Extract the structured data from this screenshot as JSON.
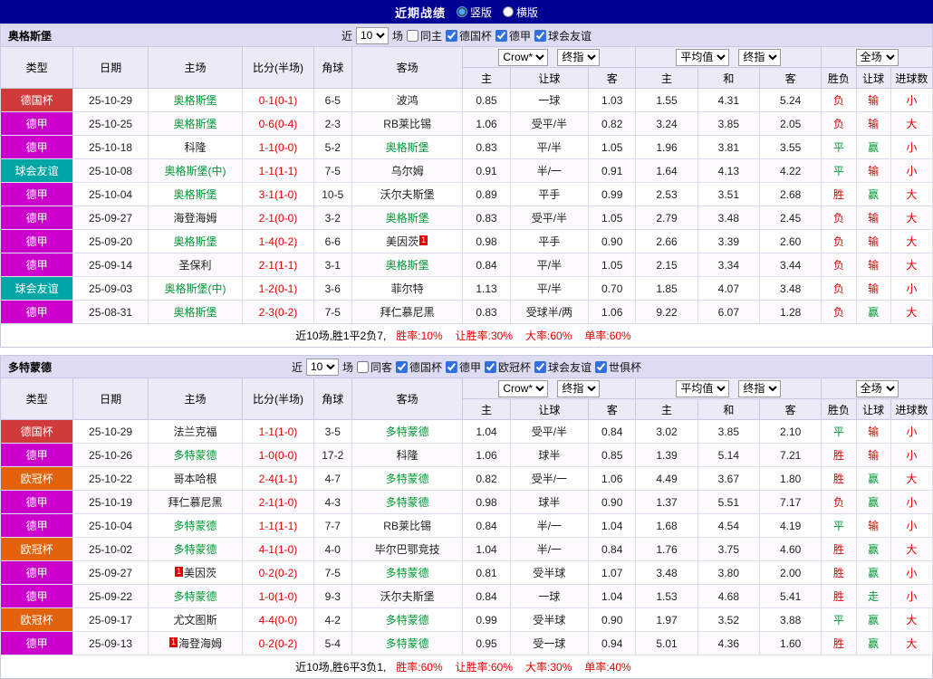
{
  "page": {
    "title": "近期战绩",
    "layout_options": [
      {
        "label": "竖版",
        "selected": true
      },
      {
        "label": "横版",
        "selected": false
      }
    ]
  },
  "colors": {
    "red": "#e60000",
    "green": "#009933",
    "focal_team": "#009933",
    "topbar_bg": "#000093",
    "result_colors": {
      "胜": "#e60000",
      "负": "#e60000",
      "平": "#009933",
      "赢": "#009933",
      "输": "#e60000",
      "走": "#009933",
      "大": "#e60000",
      "小": "#e60000"
    },
    "league_colors": {
      "德国杯": "#d03a3a",
      "德甲": "#cc00cc",
      "球会友谊": "#00a6a6",
      "欧冠杯": "#e2620d"
    }
  },
  "filter_labels": {
    "prefix": "近",
    "count": "10",
    "suffix": "场"
  },
  "table_header": {
    "static_cols": [
      "类型",
      "日期",
      "主场",
      "比分(半场)",
      "角球",
      "客场"
    ],
    "groups": [
      {
        "selects": [
          "Crow*",
          "终指"
        ],
        "sub": [
          "主",
          "让球",
          "客"
        ]
      },
      {
        "selects": [
          "平均值",
          "终指"
        ],
        "sub": [
          "主",
          "和",
          "客"
        ]
      },
      {
        "selects": [
          "全场"
        ],
        "sub": [
          "胜负",
          "让球",
          "进球数"
        ]
      }
    ]
  },
  "sections": [
    {
      "team": "奥格斯堡",
      "venue_filter": {
        "label": "同主",
        "checked": false
      },
      "league_filters": [
        {
          "label": "德国杯",
          "checked": true
        },
        {
          "label": "德甲",
          "checked": true
        },
        {
          "label": "球会友谊",
          "checked": true
        }
      ],
      "rows": [
        {
          "league": "德国杯",
          "date": "25-10-29",
          "home": {
            "name": "奥格斯堡",
            "focal": true
          },
          "score": "0-1(0-1)",
          "corners": "6-5",
          "away": {
            "name": "波鸿"
          },
          "asian": [
            "0.85",
            "一球",
            "1.03"
          ],
          "euro": [
            "1.55",
            "4.31",
            "5.24"
          ],
          "results": [
            "负",
            "输",
            "小"
          ]
        },
        {
          "league": "德甲",
          "date": "25-10-25",
          "home": {
            "name": "奥格斯堡",
            "focal": true
          },
          "score": "0-6(0-4)",
          "corners": "2-3",
          "away": {
            "name": "RB莱比锡"
          },
          "asian": [
            "1.06",
            "受平/半",
            "0.82"
          ],
          "euro": [
            "3.24",
            "3.85",
            "2.05"
          ],
          "results": [
            "负",
            "输",
            "大"
          ]
        },
        {
          "league": "德甲",
          "date": "25-10-18",
          "home": {
            "name": "科隆"
          },
          "score": "1-1(0-0)",
          "corners": "5-2",
          "away": {
            "name": "奥格斯堡",
            "focal": true
          },
          "asian": [
            "0.83",
            "平/半",
            "1.05"
          ],
          "euro": [
            "1.96",
            "3.81",
            "3.55"
          ],
          "results": [
            "平",
            "赢",
            "小"
          ]
        },
        {
          "league": "球会友谊",
          "date": "25-10-08",
          "home": {
            "name": "奥格斯堡(中)",
            "focal": true
          },
          "score": "1-1(1-1)",
          "corners": "7-5",
          "away": {
            "name": "乌尔姆"
          },
          "asian": [
            "0.91",
            "半/一",
            "0.91"
          ],
          "euro": [
            "1.64",
            "4.13",
            "4.22"
          ],
          "results": [
            "平",
            "输",
            "小"
          ]
        },
        {
          "league": "德甲",
          "date": "25-10-04",
          "home": {
            "name": "奥格斯堡",
            "focal": true
          },
          "score": "3-1(1-0)",
          "corners": "10-5",
          "away": {
            "name": "沃尔夫斯堡"
          },
          "asian": [
            "0.89",
            "平手",
            "0.99"
          ],
          "euro": [
            "2.53",
            "3.51",
            "2.68"
          ],
          "results": [
            "胜",
            "赢",
            "大"
          ]
        },
        {
          "league": "德甲",
          "date": "25-09-27",
          "home": {
            "name": "海登海姆"
          },
          "score": "2-1(0-0)",
          "corners": "3-2",
          "away": {
            "name": "奥格斯堡",
            "focal": true
          },
          "asian": [
            "0.83",
            "受平/半",
            "1.05"
          ],
          "euro": [
            "2.79",
            "3.48",
            "2.45"
          ],
          "results": [
            "负",
            "输",
            "大"
          ]
        },
        {
          "league": "德甲",
          "date": "25-09-20",
          "home": {
            "name": "奥格斯堡",
            "focal": true
          },
          "score": "1-4(0-2)",
          "corners": "6-6",
          "away": {
            "name": "美因茨",
            "red_card": "1",
            "badge_pos": "after"
          },
          "asian": [
            "0.98",
            "平手",
            "0.90"
          ],
          "euro": [
            "2.66",
            "3.39",
            "2.60"
          ],
          "results": [
            "负",
            "输",
            "大"
          ]
        },
        {
          "league": "德甲",
          "date": "25-09-14",
          "home": {
            "name": "圣保利"
          },
          "score": "2-1(1-1)",
          "corners": "3-1",
          "away": {
            "name": "奥格斯堡",
            "focal": true
          },
          "asian": [
            "0.84",
            "平/半",
            "1.05"
          ],
          "euro": [
            "2.15",
            "3.34",
            "3.44"
          ],
          "results": [
            "负",
            "输",
            "大"
          ]
        },
        {
          "league": "球会友谊",
          "date": "25-09-03",
          "home": {
            "name": "奥格斯堡(中)",
            "focal": true
          },
          "score": "1-2(0-1)",
          "corners": "3-6",
          "away": {
            "name": "菲尔特"
          },
          "asian": [
            "1.13",
            "平/半",
            "0.70"
          ],
          "euro": [
            "1.85",
            "4.07",
            "3.48"
          ],
          "results": [
            "负",
            "输",
            "小"
          ]
        },
        {
          "league": "德甲",
          "date": "25-08-31",
          "home": {
            "name": "奥格斯堡",
            "focal": true
          },
          "score": "2-3(0-2)",
          "corners": "7-5",
          "away": {
            "name": "拜仁慕尼黑"
          },
          "asian": [
            "0.83",
            "受球半/两",
            "1.06"
          ],
          "euro": [
            "9.22",
            "6.07",
            "1.28"
          ],
          "results": [
            "负",
            "赢",
            "大"
          ]
        }
      ],
      "summary": {
        "prefix": "近10场,胜1平2负7,",
        "stats": [
          "胜率:10%",
          "让胜率:30%",
          "大率:60%",
          "单率:60%"
        ]
      }
    },
    {
      "team": "多特蒙德",
      "venue_filter": {
        "label": "同客",
        "checked": false
      },
      "league_filters": [
        {
          "label": "德国杯",
          "checked": true
        },
        {
          "label": "德甲",
          "checked": true
        },
        {
          "label": "欧冠杯",
          "checked": true
        },
        {
          "label": "球会友谊",
          "checked": true
        },
        {
          "label": "世俱杯",
          "checked": true
        }
      ],
      "rows": [
        {
          "league": "德国杯",
          "date": "25-10-29",
          "home": {
            "name": "法兰克福"
          },
          "score": "1-1(1-0)",
          "corners": "3-5",
          "away": {
            "name": "多特蒙德",
            "focal": true
          },
          "asian": [
            "1.04",
            "受平/半",
            "0.84"
          ],
          "euro": [
            "3.02",
            "3.85",
            "2.10"
          ],
          "results": [
            "平",
            "输",
            "小"
          ]
        },
        {
          "league": "德甲",
          "date": "25-10-26",
          "home": {
            "name": "多特蒙德",
            "focal": true
          },
          "score": "1-0(0-0)",
          "corners": "17-2",
          "away": {
            "name": "科隆"
          },
          "asian": [
            "1.06",
            "球半",
            "0.85"
          ],
          "euro": [
            "1.39",
            "5.14",
            "7.21"
          ],
          "results": [
            "胜",
            "输",
            "小"
          ]
        },
        {
          "league": "欧冠杯",
          "date": "25-10-22",
          "home": {
            "name": "哥本哈根"
          },
          "score": "2-4(1-1)",
          "corners": "4-7",
          "away": {
            "name": "多特蒙德",
            "focal": true
          },
          "asian": [
            "0.82",
            "受半/一",
            "1.06"
          ],
          "euro": [
            "4.49",
            "3.67",
            "1.80"
          ],
          "results": [
            "胜",
            "赢",
            "大"
          ]
        },
        {
          "league": "德甲",
          "date": "25-10-19",
          "home": {
            "name": "拜仁慕尼黑"
          },
          "score": "2-1(1-0)",
          "corners": "4-3",
          "away": {
            "name": "多特蒙德",
            "focal": true
          },
          "asian": [
            "0.98",
            "球半",
            "0.90"
          ],
          "euro": [
            "1.37",
            "5.51",
            "7.17"
          ],
          "results": [
            "负",
            "赢",
            "小"
          ]
        },
        {
          "league": "德甲",
          "date": "25-10-04",
          "home": {
            "name": "多特蒙德",
            "focal": true
          },
          "score": "1-1(1-1)",
          "corners": "7-7",
          "away": {
            "name": "RB莱比锡"
          },
          "asian": [
            "0.84",
            "半/一",
            "1.04"
          ],
          "euro": [
            "1.68",
            "4.54",
            "4.19"
          ],
          "results": [
            "平",
            "输",
            "小"
          ]
        },
        {
          "league": "欧冠杯",
          "date": "25-10-02",
          "home": {
            "name": "多特蒙德",
            "focal": true
          },
          "score": "4-1(1-0)",
          "corners": "4-0",
          "away": {
            "name": "毕尔巴鄂竞技"
          },
          "asian": [
            "1.04",
            "半/一",
            "0.84"
          ],
          "euro": [
            "1.76",
            "3.75",
            "4.60"
          ],
          "results": [
            "胜",
            "赢",
            "大"
          ]
        },
        {
          "league": "德甲",
          "date": "25-09-27",
          "home": {
            "name": "美因茨",
            "red_card": "1",
            "badge_pos": "before"
          },
          "score": "0-2(0-2)",
          "corners": "7-5",
          "away": {
            "name": "多特蒙德",
            "focal": true
          },
          "asian": [
            "0.81",
            "受半球",
            "1.07"
          ],
          "euro": [
            "3.48",
            "3.80",
            "2.00"
          ],
          "results": [
            "胜",
            "赢",
            "小"
          ]
        },
        {
          "league": "德甲",
          "date": "25-09-22",
          "home": {
            "name": "多特蒙德",
            "focal": true
          },
          "score": "1-0(1-0)",
          "corners": "9-3",
          "away": {
            "name": "沃尔夫斯堡"
          },
          "asian": [
            "0.84",
            "一球",
            "1.04"
          ],
          "euro": [
            "1.53",
            "4.68",
            "5.41"
          ],
          "results": [
            "胜",
            "走",
            "小"
          ]
        },
        {
          "league": "欧冠杯",
          "date": "25-09-17",
          "home": {
            "name": "尤文图斯"
          },
          "score": "4-4(0-0)",
          "corners": "4-2",
          "away": {
            "name": "多特蒙德",
            "focal": true
          },
          "asian": [
            "0.99",
            "受半球",
            "0.90"
          ],
          "euro": [
            "1.97",
            "3.52",
            "3.88"
          ],
          "results": [
            "平",
            "赢",
            "大"
          ]
        },
        {
          "league": "德甲",
          "date": "25-09-13",
          "home": {
            "name": "海登海姆",
            "red_card": "1",
            "badge_pos": "before"
          },
          "score": "0-2(0-2)",
          "corners": "5-4",
          "away": {
            "name": "多特蒙德",
            "focal": true
          },
          "asian": [
            "0.95",
            "受一球",
            "0.94"
          ],
          "euro": [
            "5.01",
            "4.36",
            "1.60"
          ],
          "results": [
            "胜",
            "赢",
            "大"
          ]
        }
      ],
      "summary": {
        "prefix": "近10场,胜6平3负1,",
        "stats": [
          "胜率:60%",
          "让胜率:60%",
          "大率:30%",
          "单率:40%"
        ]
      }
    }
  ]
}
